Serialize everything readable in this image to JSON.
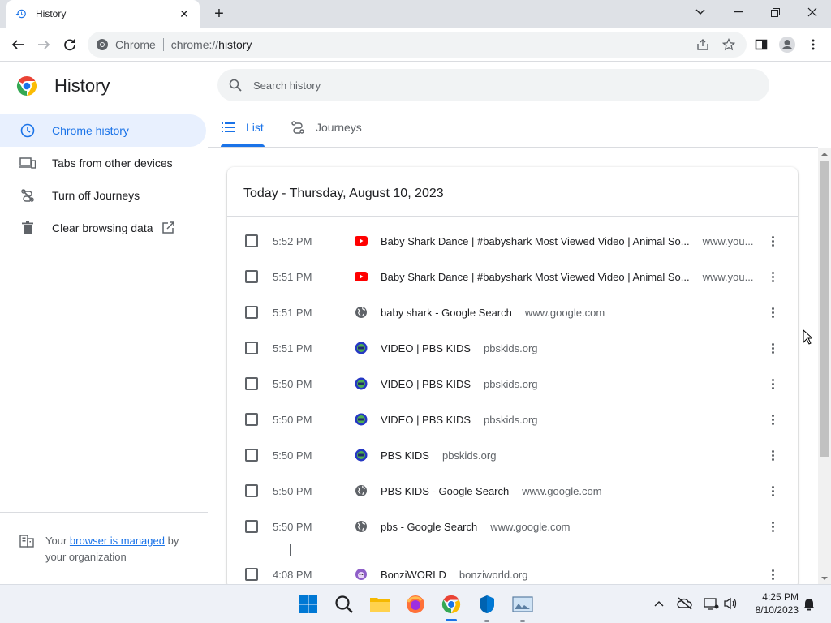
{
  "browser": {
    "tab_title": "History",
    "omnibox_site": "Chrome",
    "omnibox_url": "chrome://history",
    "url_scheme": "chrome://",
    "url_host": "history"
  },
  "sidebar": {
    "title": "History",
    "items": [
      {
        "label": "Chrome history",
        "icon": "clock-icon",
        "active": true
      },
      {
        "label": "Tabs from other devices",
        "icon": "devices-icon",
        "active": false
      },
      {
        "label": "Turn off Journeys",
        "icon": "journeys-off-icon",
        "active": false
      },
      {
        "label": "Clear browsing data",
        "icon": "trash-icon",
        "active": false
      }
    ],
    "managed_prefix": "Your",
    "managed_link": "browser is managed",
    "managed_suffix": "by",
    "managed_line2": "your organization"
  },
  "search": {
    "placeholder": "Search history"
  },
  "tabs": [
    {
      "label": "List",
      "active": true
    },
    {
      "label": "Journeys",
      "active": false
    }
  ],
  "card": {
    "date_heading": "Today - Thursday, August 10, 2023",
    "entries": [
      {
        "time": "5:52 PM",
        "title": "Baby Shark Dance | #babyshark Most Viewed Video | Animal So...",
        "domain": "www.you...",
        "favicon": "youtube-icon"
      },
      {
        "time": "5:51 PM",
        "title": "Baby Shark Dance | #babyshark Most Viewed Video | Animal So...",
        "domain": "www.you...",
        "favicon": "youtube-icon"
      },
      {
        "time": "5:51 PM",
        "title": "baby shark - Google Search",
        "domain": "www.google.com",
        "favicon": "globe-icon"
      },
      {
        "time": "5:51 PM",
        "title": "VIDEO | PBS KIDS",
        "domain": "pbskids.org",
        "favicon": "pbs-kids-icon"
      },
      {
        "time": "5:50 PM",
        "title": "VIDEO | PBS KIDS",
        "domain": "pbskids.org",
        "favicon": "pbs-kids-icon"
      },
      {
        "time": "5:50 PM",
        "title": "VIDEO | PBS KIDS",
        "domain": "pbskids.org",
        "favicon": "pbs-kids-icon"
      },
      {
        "time": "5:50 PM",
        "title": "PBS KIDS",
        "domain": "pbskids.org",
        "favicon": "pbs-kids-icon"
      },
      {
        "time": "5:50 PM",
        "title": "PBS KIDS - Google Search",
        "domain": "www.google.com",
        "favicon": "globe-icon"
      },
      {
        "time": "5:50 PM",
        "title": "pbs - Google Search",
        "domain": "www.google.com",
        "favicon": "globe-icon"
      },
      {
        "time": "4:08 PM",
        "title": "BonziWORLD",
        "domain": "bonziworld.org",
        "favicon": "bonzi-icon"
      }
    ]
  },
  "taskbar": {
    "apps": [
      "windows-start-icon",
      "search-icon",
      "file-explorer-icon",
      "firefox-icon",
      "chrome-icon",
      "defender-icon",
      "photos-icon"
    ],
    "clock_time": "4:25 PM",
    "clock_date": "8/10/2023"
  },
  "colors": {
    "accent": "#1a73e8",
    "active_bg": "#e8f0fe",
    "youtube_red": "#ff0000",
    "tabbar_bg": "#dee1e6"
  }
}
